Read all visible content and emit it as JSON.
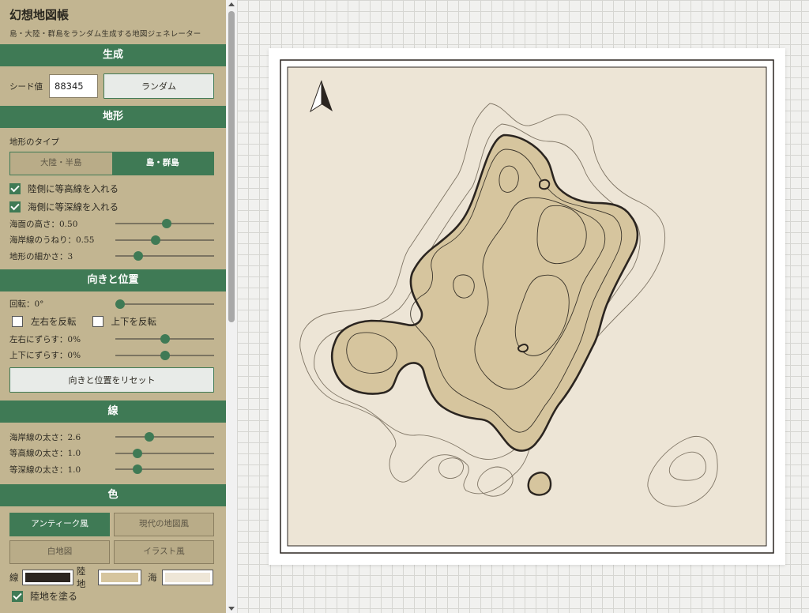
{
  "app": {
    "title": "幻想地図帳",
    "subtitle": "島・大陸・群島をランダム生成する地図ジェネレーター"
  },
  "generate": {
    "header": "生成",
    "seed_label": "シード値",
    "seed_value": "88345",
    "random_label": "ランダム"
  },
  "terrain": {
    "header": "地形",
    "type_label": "地形のタイプ",
    "types": [
      "大陸・半島",
      "島・群島"
    ],
    "selected_type": "島・群島",
    "land_contours_label": "陸側に等高線を入れる",
    "land_contours_checked": true,
    "sea_contours_label": "海側に等深線を入れる",
    "sea_contours_checked": true,
    "sea_level_label": "海面の高さ：0.50",
    "sea_level_value": 0.5,
    "coast_wave_label": "海岸線のうねり：0.55",
    "coast_wave_value": 0.55,
    "detail_label": "地形の細かさ：3",
    "detail_value": 3
  },
  "orientation": {
    "header": "向きと位置",
    "rotation_label": "回転：0°",
    "rotation_value": 0,
    "flip_h_label": "左右を反転",
    "flip_h_checked": false,
    "flip_v_label": "上下を反転",
    "flip_v_checked": false,
    "shift_x_label": "左右にずらす：0%",
    "shift_x_value": 0,
    "shift_y_label": "上下にずらす：0%",
    "shift_y_value": 0,
    "reset_label": "向きと位置をリセット"
  },
  "lines": {
    "header": "線",
    "coast_width_label": "海岸線の太さ：2.6",
    "coast_width_value": 2.6,
    "contour_width_label": "等高線の太さ：1.0",
    "contour_width_value": 1.0,
    "depth_width_label": "等深線の太さ：1.0",
    "depth_width_value": 1.0
  },
  "colors": {
    "header": "色",
    "presets": [
      "アンティーク風",
      "現代の地図風",
      "白地図",
      "イラスト風"
    ],
    "selected_preset": "アンティーク風",
    "line_label": "線",
    "line_color": "#2b2520",
    "land_label": "陸地",
    "land_color": "#d6c59e",
    "sea_label": "海",
    "sea_color": "#eee6d7",
    "fill_land_label": "陸地を塗る",
    "fill_land_checked": true
  },
  "map": {
    "background_color": "#ede5d6",
    "accent_color": "#3f7a55",
    "compass_icon": "north-arrow-icon"
  }
}
